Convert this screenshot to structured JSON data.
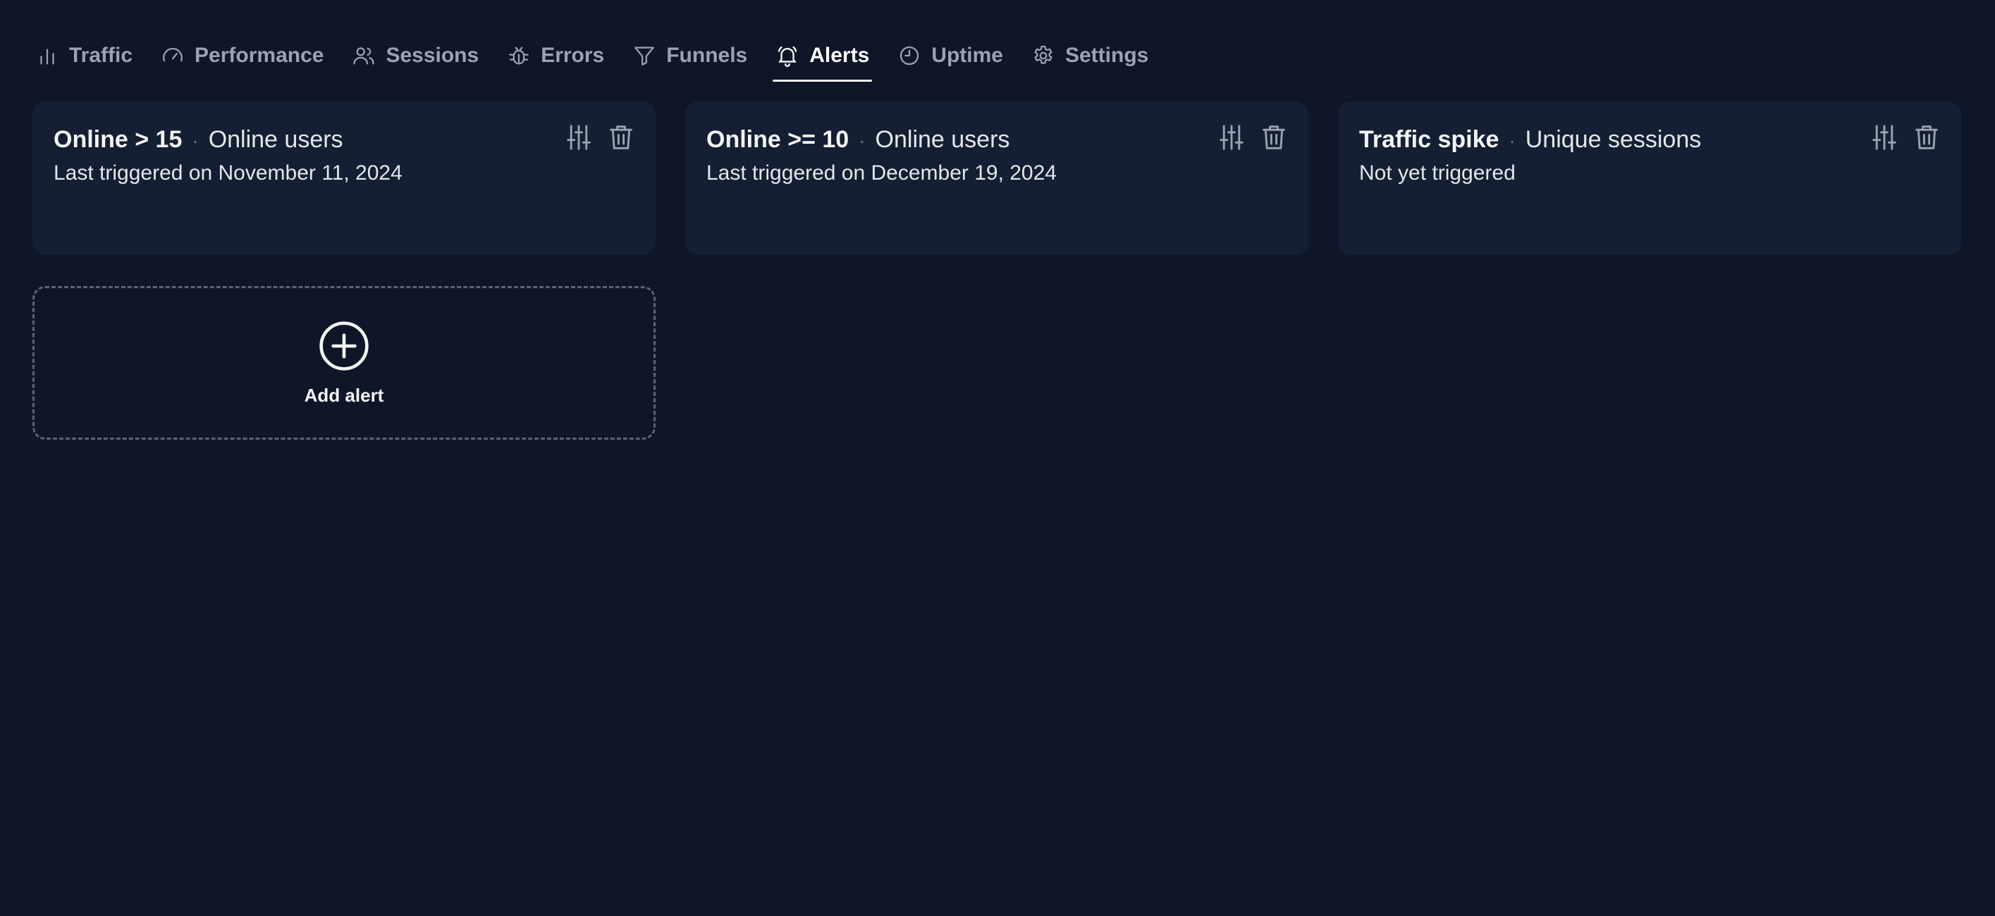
{
  "nav": {
    "tabs": [
      {
        "id": "traffic",
        "label": "Traffic",
        "icon": "bar-chart-icon"
      },
      {
        "id": "performance",
        "label": "Performance",
        "icon": "gauge-icon"
      },
      {
        "id": "sessions",
        "label": "Sessions",
        "icon": "users-icon"
      },
      {
        "id": "errors",
        "label": "Errors",
        "icon": "bug-icon"
      },
      {
        "id": "funnels",
        "label": "Funnels",
        "icon": "funnel-icon"
      },
      {
        "id": "alerts",
        "label": "Alerts",
        "icon": "bell-icon"
      },
      {
        "id": "uptime",
        "label": "Uptime",
        "icon": "clock-icon"
      },
      {
        "id": "settings",
        "label": "Settings",
        "icon": "gear-icon"
      }
    ],
    "active": "alerts"
  },
  "alerts": [
    {
      "name": "Online > 15",
      "metric": "Online users",
      "status": "Last triggered on November 11, 2024"
    },
    {
      "name": "Online >= 10",
      "metric": "Online users",
      "status": "Last triggered on December 19, 2024"
    },
    {
      "name": "Traffic spike",
      "metric": "Unique sessions",
      "status": "Not yet triggered"
    }
  ],
  "separator": "·",
  "add_alert": {
    "label": "Add alert",
    "icon": "plus-circle-icon"
  },
  "actions": {
    "edit_icon": "sliders-icon",
    "delete_icon": "trash-icon"
  },
  "colors": {
    "background": "#0e1628",
    "card": "#141f33",
    "active_tab": "#ffffff",
    "inactive_tab": "#9ca3af"
  }
}
